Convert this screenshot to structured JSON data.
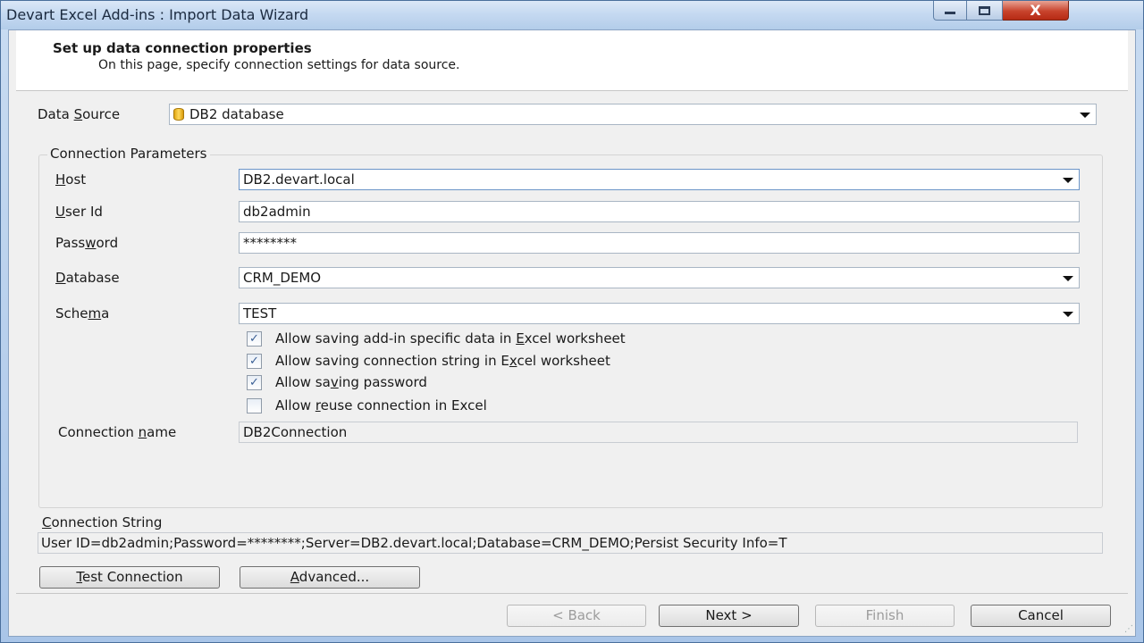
{
  "window": {
    "title": "Devart Excel Add-ins : Import Data Wizard",
    "close_glyph": "X"
  },
  "header": {
    "title": "Set up data connection properties",
    "subtitle": "On this page, specify connection settings for data source."
  },
  "data_source": {
    "label_pre": "Data ",
    "label_u": "S",
    "label_post": "ource",
    "value": "DB2 database",
    "icon": "database-icon"
  },
  "params": {
    "group_title": "Connection Parameters",
    "host": {
      "label_u": "H",
      "label_post": "ost",
      "value": "DB2.devart.local"
    },
    "user_id": {
      "label_u": "U",
      "label_post": "ser Id",
      "value": "db2admin"
    },
    "password": {
      "label_pre": "Pass",
      "label_u": "w",
      "label_post": "ord",
      "value": "********"
    },
    "database": {
      "label_u": "D",
      "label_post": "atabase",
      "value": "CRM_DEMO"
    },
    "schema": {
      "label_pre": "Sche",
      "label_u": "m",
      "label_post": "a",
      "value": "TEST"
    },
    "checkboxes": [
      {
        "pre": "Allow saving add-in specific data in ",
        "u": "E",
        "post": "xcel worksheet",
        "checked": true
      },
      {
        "pre": "Allow saving connection string in E",
        "u": "x",
        "post": "cel worksheet",
        "checked": true
      },
      {
        "pre": "Allow sa",
        "u": "v",
        "post": "ing password",
        "checked": true
      },
      {
        "pre": "Allow ",
        "u": "r",
        "post": "euse connection in Excel",
        "checked": false
      }
    ],
    "connection_name": {
      "label_pre": "Connection ",
      "label_u": "n",
      "label_post": "ame",
      "value": "DB2Connection"
    }
  },
  "connection_string": {
    "label_u": "C",
    "label_post": "onnection String",
    "value": "User ID=db2admin;Password=********;Server=DB2.devart.local;Database=CRM_DEMO;Persist Security Info=T"
  },
  "buttons": {
    "test_u": "T",
    "test_post": "est Connection",
    "advanced_u": "A",
    "advanced_post": "dvanced...",
    "back": "< Back",
    "next": "Next >",
    "finish": "Finish",
    "cancel": "Cancel"
  },
  "check_glyph": "✓"
}
